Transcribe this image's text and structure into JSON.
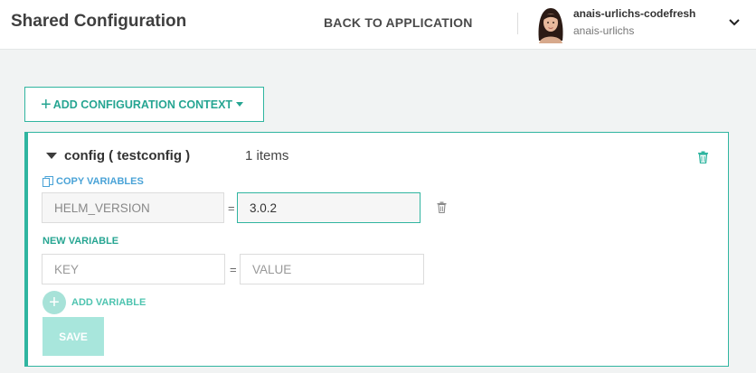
{
  "header": {
    "title": "Shared Configuration",
    "back_link": "BACK TO APPLICATION",
    "user": {
      "display_name": "anais-urlichs-codefresh",
      "login": "anais-urlichs"
    }
  },
  "toolbar": {
    "add_context_label": "ADD CONFIGURATION CONTEXT"
  },
  "context": {
    "title": "config ( testconfig )",
    "item_count": "1 items",
    "copy_variables_label": "COPY VARIABLES",
    "variables": [
      {
        "key": "HELM_VERSION",
        "value": "3.0.2"
      }
    ],
    "equals_sign": "=",
    "new_variable": {
      "label": "NEW VARIABLE",
      "key_placeholder": "KEY",
      "value_placeholder": "VALUE"
    },
    "add_variable_label": "ADD VARIABLE",
    "save_label": "SAVE"
  },
  "colors": {
    "accent": "#30b5a0",
    "link_blue": "#4aa3d7",
    "disabled_save": "#a8e6dc"
  },
  "icons": [
    "chevron-down-icon",
    "plus-icon",
    "caret-down-icon",
    "triangle-down-icon",
    "trash-icon",
    "copy-icon",
    "plus-circle-icon"
  ]
}
